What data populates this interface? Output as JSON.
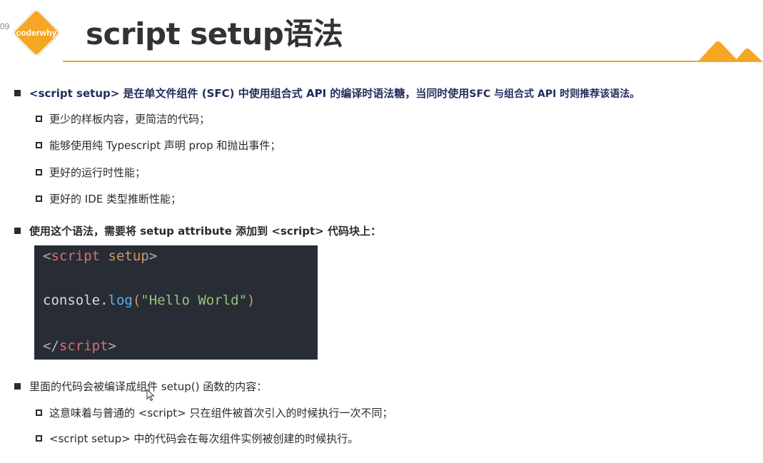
{
  "page": {
    "number": "09",
    "logo_text": "coderwhy",
    "title": "script setup语法"
  },
  "bullets": {
    "b1": {
      "text_a": "<script setup> 是在单文件组件 (SFC) 中使用组合式 API 的编译时语法糖，当同时使用 ",
      "text_b": "SFC 与组合式 API 时则推荐该语法。",
      "subs": [
        "更少的样板内容，更简洁的代码；",
        "能够使用纯 Typescript 声明 prop 和抛出事件；",
        "更好的运行时性能；",
        "更好的 IDE 类型推断性能；"
      ]
    },
    "b2": {
      "text": "使用这个语法，需要将 setup attribute 添加到 <script> 代码块上："
    },
    "b3": {
      "text": "里面的代码会被编译成组件 setup() 函数的内容：",
      "subs": [
        "这意味着与普通的 <script> 只在组件被首次引入的时候执行一次不同；",
        "<script setup> 中的代码会在每次组件实例被创建的时候执行。"
      ]
    }
  },
  "code": {
    "line1": {
      "open": "<",
      "tag": "script",
      "space": " ",
      "attr": "setup",
      "close": ">"
    },
    "line2": {
      "obj": "console.",
      "fn": "log",
      "paren_open": "(",
      "str": "\"Hello World\"",
      "paren_close": ")"
    },
    "line3": {
      "open": "</",
      "tag": "script",
      "close": ">"
    }
  },
  "colors": {
    "accent": "#f5a623",
    "code_bg": "#282c34",
    "code_tag": "#e06c75",
    "code_attr": "#d19a66",
    "code_fn": "#61afef",
    "code_str": "#98c379"
  }
}
